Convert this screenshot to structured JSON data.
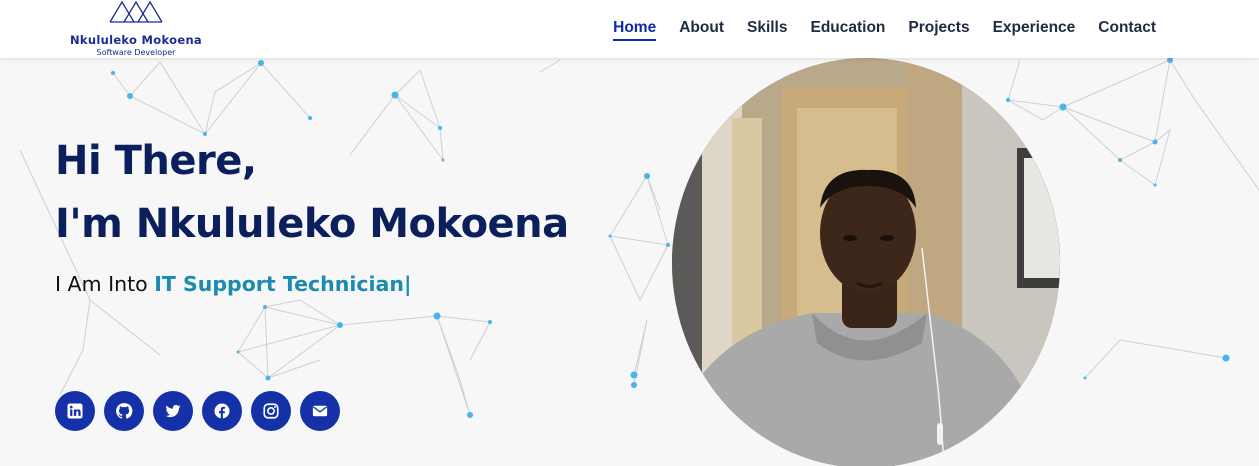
{
  "brand": {
    "name": "Nkululeko Mokoena",
    "tagline": "Software Developer"
  },
  "nav": {
    "items": [
      {
        "label": "Home",
        "active": true
      },
      {
        "label": "About"
      },
      {
        "label": "Skills"
      },
      {
        "label": "Education"
      },
      {
        "label": "Projects"
      },
      {
        "label": "Experience"
      },
      {
        "label": "Contact"
      }
    ]
  },
  "hero": {
    "greeting": "Hi There,",
    "intro": "I'm Nkululeko Mokoena",
    "typed_prefix": "I Am Into",
    "typed_role": "IT Support Technician|"
  },
  "socials": [
    {
      "icon": "linkedin-icon"
    },
    {
      "icon": "github-icon"
    },
    {
      "icon": "twitter-icon"
    },
    {
      "icon": "facebook-icon"
    },
    {
      "icon": "instagram-icon"
    },
    {
      "icon": "email-icon"
    }
  ],
  "colors": {
    "primary": "#1431a8",
    "heading": "#0a1f5c",
    "accent": "#1b8bb0",
    "nav_active": "#0b2bb0"
  }
}
